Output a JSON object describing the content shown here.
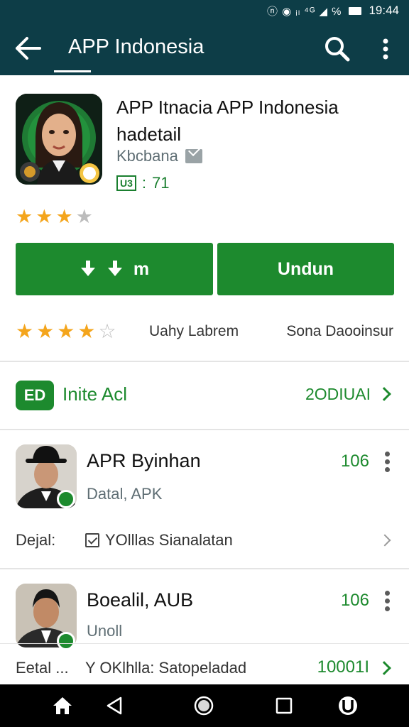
{
  "status_bar": {
    "icons": "ⓝ ◉ ᵢₗ ⁴ᴳ ◢ ℅",
    "time": "19:44"
  },
  "toolbar": {
    "title": "APP Indonesia"
  },
  "app": {
    "title": "APP Itnacia APP Indonesia hadetail",
    "developer": "Kbcbana",
    "meta_badge": "U3",
    "meta_separator": ":",
    "meta_value": "71",
    "rating_stars": 3
  },
  "buttons": {
    "download_label": "m",
    "install_label": "Undun"
  },
  "rating_row": {
    "stars": 4,
    "left_label": "Uahy Labrem",
    "right_label": "Sona Daooinsur"
  },
  "invite": {
    "icon_text": "ED",
    "label": "Inite Acl",
    "value": "2ODIUAI"
  },
  "list": [
    {
      "title": "APR Byinhan",
      "subtitle": "Datal, APK",
      "count": "106",
      "detail_label": "Dejal:",
      "detail_text": "YOlllas Sianalatan"
    },
    {
      "title": "Boealil, AUB",
      "subtitle": "Unoll",
      "count": "106",
      "detail_label": "Eetal ...",
      "detail_text": "Y OKlhlla: Satopeladad",
      "detail_value": "10001I"
    }
  ],
  "colors": {
    "header": "#0d3d47",
    "accent_green": "#1d8a2e",
    "star": "#f4a51c"
  }
}
